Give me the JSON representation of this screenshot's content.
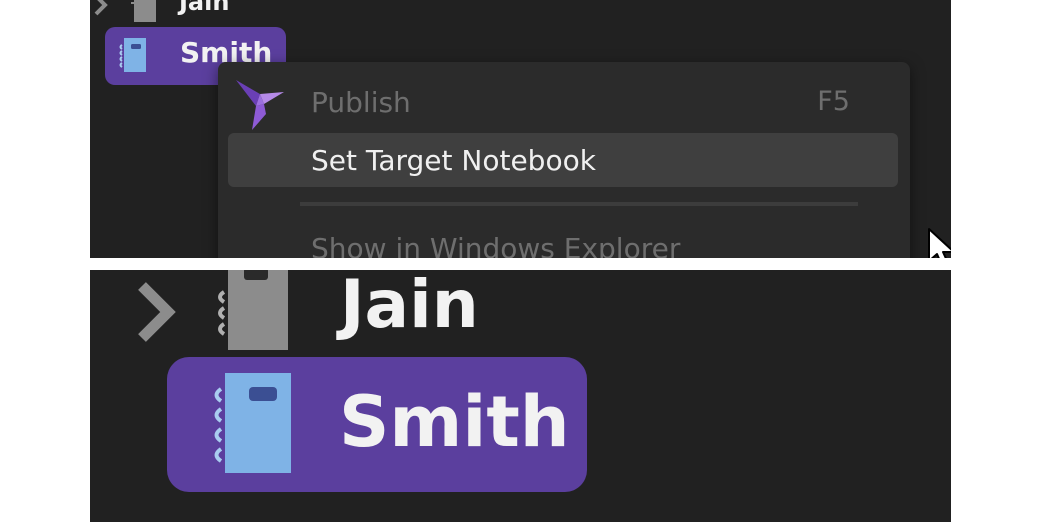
{
  "tree": {
    "items": [
      {
        "label": "Jain",
        "icon": "notebook-gray-icon",
        "expanded": false
      },
      {
        "label": "Smith",
        "icon": "notebook-blue-icon",
        "selected": true
      }
    ]
  },
  "context_menu": {
    "items": [
      {
        "label": "Publish",
        "shortcut": "F5",
        "enabled": false,
        "icon": "publish-bird-icon"
      },
      {
        "label": "Set Target Notebook",
        "enabled": true,
        "hovered": true
      },
      {
        "label": "Show in Windows Explorer",
        "enabled": false
      }
    ]
  },
  "zoom": {
    "items": [
      {
        "label": "Jain"
      },
      {
        "label": "Smith"
      }
    ]
  },
  "colors": {
    "background": "#212121",
    "selection": "#5b3f9e",
    "menu": "#2b2b2b",
    "menu_hover": "#3f3f3f",
    "notebook_blue": "#7fb3e6",
    "notebook_gray": "#8c8c8c",
    "publish_icon": "#8e5bd6"
  }
}
